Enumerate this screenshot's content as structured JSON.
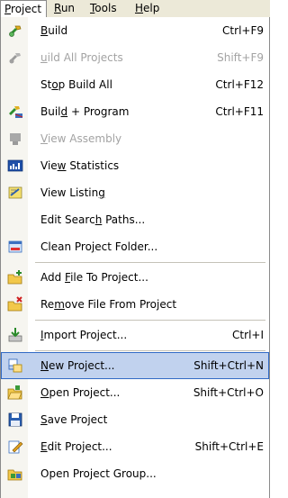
{
  "menubar": {
    "items": [
      {
        "pre": "",
        "acc": "P",
        "post": "roject"
      },
      {
        "pre": "",
        "acc": "R",
        "post": "un"
      },
      {
        "pre": "",
        "acc": "T",
        "post": "ools"
      },
      {
        "pre": "",
        "acc": "H",
        "post": "elp"
      }
    ]
  },
  "menu": {
    "items": [
      {
        "pre": "",
        "acc": "B",
        "post": "uild",
        "shortcut": "Ctrl+F9",
        "icon": "build-icon"
      },
      {
        "pre": "",
        "acc": "u",
        "post": "ild All Projects",
        "shortcut": "Shift+F9",
        "icon": "build-all-icon"
      },
      {
        "pre": "St",
        "acc": "o",
        "post": "p Build All",
        "shortcut": "Ctrl+F12",
        "icon": ""
      },
      {
        "pre": "Buil",
        "acc": "d",
        "post": " + Program",
        "shortcut": "Ctrl+F11",
        "icon": "build-program-icon"
      },
      {
        "pre": "",
        "acc": "V",
        "post": "iew Assembly",
        "shortcut": "",
        "icon": "view-assembly-icon"
      },
      {
        "pre": "Vie",
        "acc": "w",
        "post": " Statistics",
        "shortcut": "",
        "icon": "statistics-icon"
      },
      {
        "pre": "View Listin",
        "acc": "g",
        "post": "",
        "shortcut": "",
        "icon": "listing-icon"
      },
      {
        "pre": "Edit Searc",
        "acc": "h",
        "post": " Paths...",
        "shortcut": "",
        "icon": ""
      },
      {
        "pre": "Clean Pro",
        "acc": "j",
        "post": "ect Folder...",
        "shortcut": "",
        "icon": "clean-folder-icon"
      },
      {
        "pre": "Add ",
        "acc": "F",
        "post": "ile To Project...",
        "shortcut": "",
        "icon": "add-file-icon"
      },
      {
        "pre": "Re",
        "acc": "m",
        "post": "ove File From Project",
        "shortcut": "",
        "icon": "remove-file-icon"
      },
      {
        "pre": "",
        "acc": "I",
        "post": "mport Project...",
        "shortcut": "Ctrl+I",
        "icon": "import-project-icon"
      },
      {
        "pre": "",
        "acc": "N",
        "post": "ew Project...",
        "shortcut": "Shift+Ctrl+N",
        "icon": "new-project-icon"
      },
      {
        "pre": "",
        "acc": "O",
        "post": "pen Project...",
        "shortcut": "Shift+Ctrl+O",
        "icon": "open-project-icon"
      },
      {
        "pre": "",
        "acc": "S",
        "post": "ave Project",
        "shortcut": "",
        "icon": "save-project-icon"
      },
      {
        "pre": "",
        "acc": "E",
        "post": "dit Project...",
        "shortcut": "Shift+Ctrl+E",
        "icon": "edit-project-icon"
      },
      {
        "pre": "Open Project Group",
        "acc": "",
        "post": "...",
        "shortcut": "",
        "icon": "open-project-group-icon"
      }
    ]
  }
}
